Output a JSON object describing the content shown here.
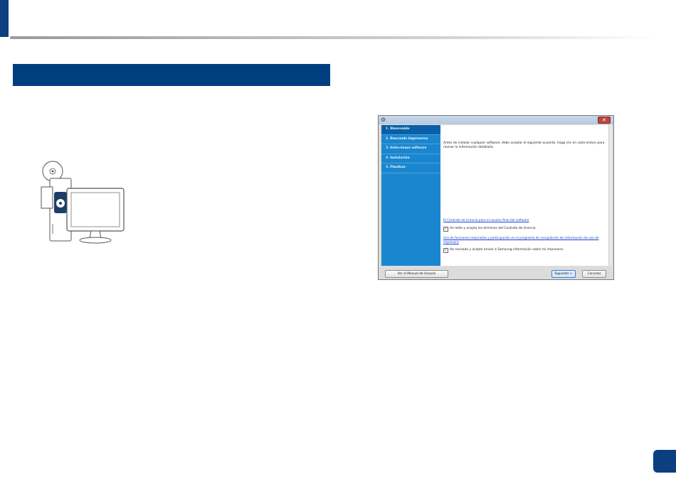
{
  "installer": {
    "close_glyph": "✕",
    "app_icon": "installer-app-icon",
    "steps": [
      {
        "label": "1. Bienvenido"
      },
      {
        "label": "2. Buscando impresoras"
      },
      {
        "label": "3. Seleccionar software"
      },
      {
        "label": "4. Instalación"
      },
      {
        "label": "5. Finalizar"
      }
    ],
    "intro_text": "Antes de instalar cualquier software, debe aceptar el siguiente acuerdo. Haga clic en cada enlace para revisar la información detallada.",
    "license_link": "El Contrato de licencia para el usuario final del software",
    "license_checkbox": "He leído y acepto los términos del Contrato de licencia.",
    "program_link": "Uso de funciones mejoradas y participación en el programa de recopilación de información de uso de impresora",
    "program_checkbox": "He revisado y acepto enviar a Samsung información sobre mi impresora.",
    "check_glyph": "✓",
    "manual_button": "Ver el Manual de Usuario",
    "next_button": "Siguiente >",
    "cancel_button": "Cancelar"
  },
  "colors": {
    "brand_blue": "#003f7f",
    "sidebar_blue": "#1a86cf",
    "sidebar_active": "#0a60a8",
    "link_blue": "#1b3fd1"
  }
}
